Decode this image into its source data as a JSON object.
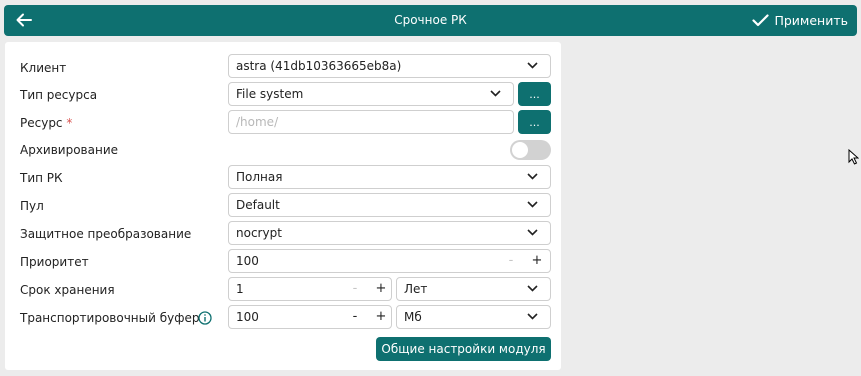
{
  "header": {
    "title": "Срочное РК",
    "apply_label": "Применить"
  },
  "form": {
    "client": {
      "label": "Клиент",
      "value": "astra (41db10363665eb8a)"
    },
    "resource_type": {
      "label": "Тип ресурса",
      "value": "File system",
      "browse_label": "..."
    },
    "resource": {
      "label": "Ресурс",
      "required_mark": "*",
      "placeholder": "/home/",
      "browse_label": "..."
    },
    "archiving": {
      "label": "Архивирование",
      "enabled": false
    },
    "backup_type": {
      "label": "Тип РК",
      "value": "Полная"
    },
    "pool": {
      "label": "Пул",
      "value": "Default"
    },
    "protection": {
      "label": "Защитное преобразование",
      "value": "nocrypt"
    },
    "priority": {
      "label": "Приоритет",
      "value": "100",
      "minus": "-",
      "plus": "+"
    },
    "retention": {
      "label": "Срок хранения",
      "value": "1",
      "minus": "-",
      "plus": "+",
      "unit": "Лет"
    },
    "transport_buffer": {
      "label": "Транспортировочный буфер",
      "value": "100",
      "minus": "-",
      "plus": "+",
      "unit": "Мб"
    },
    "module_settings_label": "Общие настройки модуля"
  },
  "colors": {
    "accent": "#0e7070",
    "background": "#ececec",
    "panel": "#ffffff",
    "required": "#d9534f",
    "toggle_off": "#d2d2d2"
  }
}
